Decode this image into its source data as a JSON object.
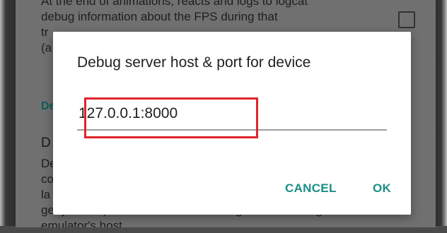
{
  "background": {
    "description_lines": [
      "At the end of animations, reacts and logs to logcat",
      "debug information about the FPS during that",
      "tr",
      "(a"
    ],
    "section_header": "De",
    "item_title": "D",
    "item_description_lines": [
      "De",
      "co",
      "la",
      "genymotion) and connection to debug server running on",
      "emulator's host"
    ]
  },
  "dialog": {
    "title": "Debug server host & port for device",
    "input_value": "127.0.0.1:8000",
    "cancel_label": "CANCEL",
    "ok_label": "OK"
  },
  "colors": {
    "accent": "#1a8f86",
    "highlight": "#e0242b",
    "scrim": "#707070"
  }
}
